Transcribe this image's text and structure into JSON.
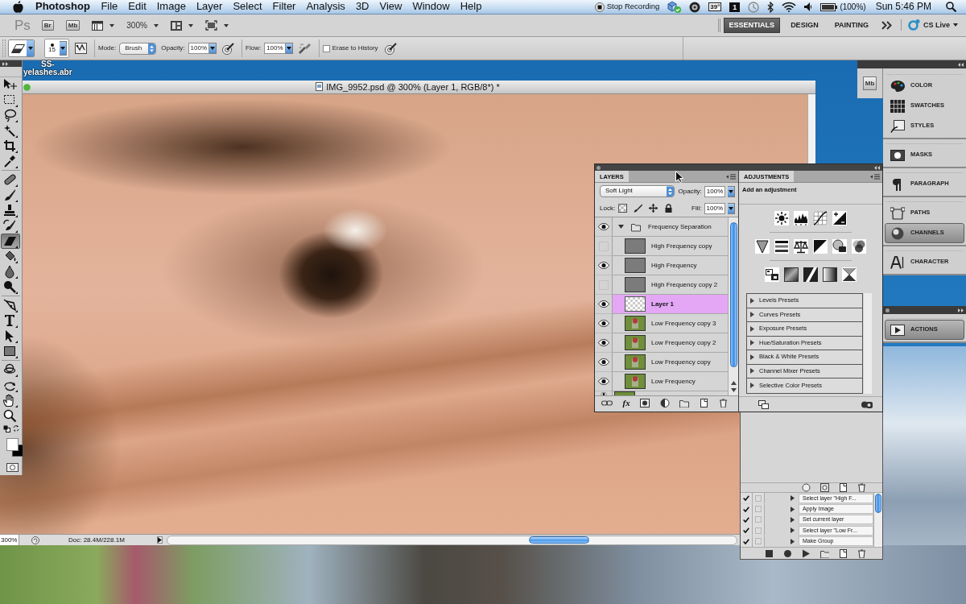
{
  "menu_bar": {
    "app_name": "Photoshop",
    "menus": [
      "File",
      "Edit",
      "Image",
      "Layer",
      "Select",
      "Filter",
      "Analysis",
      "3D",
      "View",
      "Window",
      "Help"
    ],
    "recording": "Stop Recording",
    "temperature": "39°",
    "space": "1",
    "battery": "(100%)",
    "clock": "Sun 5:46 PM"
  },
  "app_bar": {
    "logo": "Ps",
    "launch_buttons": [
      "Br",
      "Mb"
    ],
    "zoom": "300%",
    "workspaces": [
      {
        "label": "ESSENTIALS",
        "selected": true
      },
      {
        "label": "DESIGN",
        "selected": false
      },
      {
        "label": "PAINTING",
        "selected": false
      }
    ],
    "cs_live": "CS Live"
  },
  "options_bar": {
    "brush_size": "15",
    "mode_label": "Mode:",
    "mode": "Brush",
    "opacity_label": "Opacity:",
    "opacity": "100%",
    "flow_label": "Flow:",
    "flow": "100%",
    "erase_to_history": {
      "label": "Erase to History",
      "checked": false
    }
  },
  "desktop_file": {
    "lines": [
      "SS-",
      "yelashes.abr"
    ]
  },
  "tool_groups": [
    {
      "tools": [
        {
          "kind": "move",
          "selected": false
        },
        {
          "kind": "marquee",
          "selected": false
        },
        {
          "kind": "lasso",
          "selected": false
        },
        {
          "kind": "wand",
          "selected": false
        },
        {
          "kind": "crop",
          "selected": false
        },
        {
          "kind": "eyedropper",
          "selected": false
        }
      ]
    },
    {
      "tools": [
        {
          "kind": "healing",
          "selected": false
        },
        {
          "kind": "brush",
          "selected": false
        },
        {
          "kind": "stamp",
          "selected": false
        },
        {
          "kind": "history",
          "selected": false
        },
        {
          "kind": "eraser",
          "selected": true
        },
        {
          "kind": "bucket",
          "selected": false
        },
        {
          "kind": "blur",
          "selected": false
        },
        {
          "kind": "dodge",
          "selected": false
        }
      ]
    },
    {
      "tools": [
        {
          "kind": "pen",
          "selected": false
        },
        {
          "kind": "type",
          "selected": false
        },
        {
          "kind": "pathselect",
          "selected": false
        },
        {
          "kind": "shape",
          "selected": false
        }
      ]
    },
    {
      "tools": [
        {
          "kind": "rotate",
          "selected": false
        },
        {
          "kind": "orbit",
          "selected": false
        },
        {
          "kind": "hand",
          "selected": false
        },
        {
          "kind": "zoom",
          "selected": false
        }
      ]
    }
  ],
  "document": {
    "title": "IMG_9952.psd @ 300% (Layer 1, RGB/8*) *",
    "zoom": "300%",
    "doc_size": "Doc: 28.4M/228.1M"
  },
  "layers_panel": {
    "tab": "LAYERS",
    "blend_mode": "Soft Light",
    "opacity_label": "Opacity:",
    "opacity": "100%",
    "lock_label": "Lock:",
    "fill_label": "Fill:",
    "fill": "100%",
    "effects_button": "fx",
    "layers": [
      {
        "name": "Frequency Separation",
        "kind": "group",
        "visible": true,
        "selected": false,
        "expanded": true,
        "children": [
          {
            "name": "High Frequency copy",
            "kind": "gray",
            "visible": false,
            "selected": false
          },
          {
            "name": "High Frequency",
            "kind": "gray",
            "visible": true,
            "selected": false
          },
          {
            "name": "High Frequency copy 2",
            "kind": "gray",
            "visible": false,
            "selected": false
          },
          {
            "name": "Layer 1",
            "kind": "transparent",
            "visible": true,
            "selected": true
          },
          {
            "name": "Low Frequency copy 3",
            "kind": "photo",
            "visible": true,
            "selected": false
          },
          {
            "name": "Low Frequency copy 2",
            "kind": "photo",
            "visible": true,
            "selected": false
          },
          {
            "name": "Low Frequency copy",
            "kind": "photo",
            "visible": true,
            "selected": false
          },
          {
            "name": "Low Frequency",
            "kind": "photo",
            "visible": true,
            "selected": false
          }
        ]
      },
      {
        "kind": "photo",
        "visible": true,
        "selected": false
      }
    ]
  },
  "adjustments_panel": {
    "tab": "ADJUSTMENTS",
    "heading": "Add an adjustment",
    "presets": [
      {
        "label": "Levels Presets",
        "expanded": false
      },
      {
        "label": "Curves Presets",
        "expanded": false
      },
      {
        "label": "Exposure Presets",
        "expanded": false
      },
      {
        "label": "Hue/Saturation Presets",
        "expanded": false
      },
      {
        "label": "Black & White Presets",
        "expanded": false
      },
      {
        "label": "Channel Mixer Presets",
        "expanded": false
      },
      {
        "label": "Selective Color Presets",
        "expanded": false
      }
    ]
  },
  "actions_panel": {
    "steps": [
      {
        "label": "Select layer \"High F...",
        "checked": true
      },
      {
        "label": "Apply Image",
        "checked": true
      },
      {
        "label": "Set current layer",
        "checked": true
      },
      {
        "label": "Select layer \"Low Fr...",
        "checked": true
      },
      {
        "label": "Make Group",
        "checked": true
      }
    ]
  },
  "panel_dock": {
    "mini_bridge": "Mb",
    "groups": [
      {
        "items": [
          {
            "kind": "color",
            "label": "COLOR",
            "selected": false
          },
          {
            "kind": "swatches",
            "label": "SWATCHES",
            "selected": false
          },
          {
            "kind": "styles",
            "label": "STYLES",
            "selected": false
          }
        ]
      },
      {
        "items": [
          {
            "kind": "masks",
            "label": "MASKS",
            "selected": false
          }
        ]
      },
      {
        "items": [
          {
            "kind": "paragraph",
            "label": "PARAGRAPH",
            "selected": false
          }
        ]
      },
      {
        "items": [
          {
            "kind": "paths",
            "label": "PATHS",
            "selected": false
          },
          {
            "kind": "channels",
            "label": "CHANNELS",
            "selected": true
          }
        ]
      },
      {
        "items": [
          {
            "kind": "character",
            "label": "CHARACTER",
            "selected": false
          }
        ]
      }
    ],
    "lower_groups": [
      {
        "items": [
          {
            "kind": "actions",
            "label": "ACTIONS",
            "selected": true
          }
        ]
      }
    ]
  }
}
